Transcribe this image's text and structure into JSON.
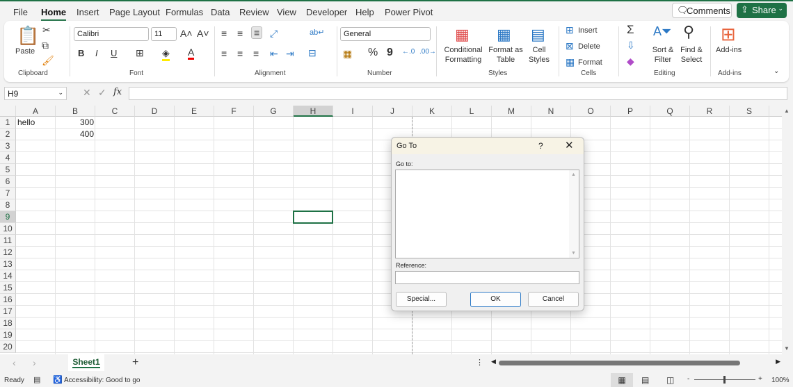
{
  "menu_tabs": [
    "File",
    "Home",
    "Insert",
    "Page Layout",
    "Formulas",
    "Data",
    "Review",
    "View",
    "Developer",
    "Help",
    "Power Pivot"
  ],
  "active_tab": "Home",
  "header_buttons": {
    "comments": "Comments",
    "share": "Share"
  },
  "ribbon": {
    "clipboard": {
      "paste": "Paste",
      "group": "Clipboard"
    },
    "font": {
      "name": "Calibri",
      "size": "11",
      "group": "Font",
      "bold": "B",
      "italic": "I",
      "underline": "U",
      "font_color": "A"
    },
    "alignment": {
      "group": "Alignment"
    },
    "number": {
      "format": "General",
      "group": "Number",
      "percent": "%",
      "comma": "9"
    },
    "styles": {
      "conditional": [
        "Conditional",
        "Formatting"
      ],
      "format_table": [
        "Format as",
        "Table"
      ],
      "cell_styles": [
        "Cell",
        "Styles"
      ],
      "group": "Styles"
    },
    "cells": {
      "insert": "Insert",
      "delete": "Delete",
      "format": "Format",
      "group": "Cells"
    },
    "editing": {
      "sort": [
        "Sort &",
        "Filter"
      ],
      "find": [
        "Find &",
        "Select"
      ],
      "group": "Editing",
      "sum": "Σ"
    },
    "addins": {
      "label": "Add-ins",
      "group": "Add-ins"
    }
  },
  "name_box": "H9",
  "fx": "fx",
  "columns": [
    "A",
    "B",
    "C",
    "D",
    "E",
    "F",
    "G",
    "H",
    "I",
    "J",
    "K",
    "L",
    "M",
    "N",
    "O",
    "P",
    "Q",
    "R",
    "S"
  ],
  "rows": [
    "1",
    "2",
    "3",
    "4",
    "5",
    "6",
    "7",
    "8",
    "9",
    "10",
    "11",
    "12",
    "13",
    "14",
    "15",
    "16",
    "17",
    "18",
    "19",
    "20"
  ],
  "cells": [
    {
      "ref": "A1",
      "col": 0,
      "row": 0,
      "value": "hello",
      "align": "left"
    },
    {
      "ref": "B1",
      "col": 1,
      "row": 0,
      "value": "300",
      "align": "right"
    },
    {
      "ref": "B2",
      "col": 1,
      "row": 1,
      "value": "400",
      "align": "right"
    }
  ],
  "selected_cell": {
    "col": 7,
    "row": 8
  },
  "dialog": {
    "title": "Go To",
    "help": "?",
    "goto_label": "Go to:",
    "reference_label": "Reference:",
    "reference_value": "",
    "special": "Special...",
    "ok": "OK",
    "cancel": "Cancel"
  },
  "sheet_tabs": [
    "Sheet1"
  ],
  "status": {
    "ready": "Ready",
    "accessibility": "Accessibility: Good to go",
    "zoom": "100%"
  },
  "colors": {
    "accent": "#1e7145"
  }
}
